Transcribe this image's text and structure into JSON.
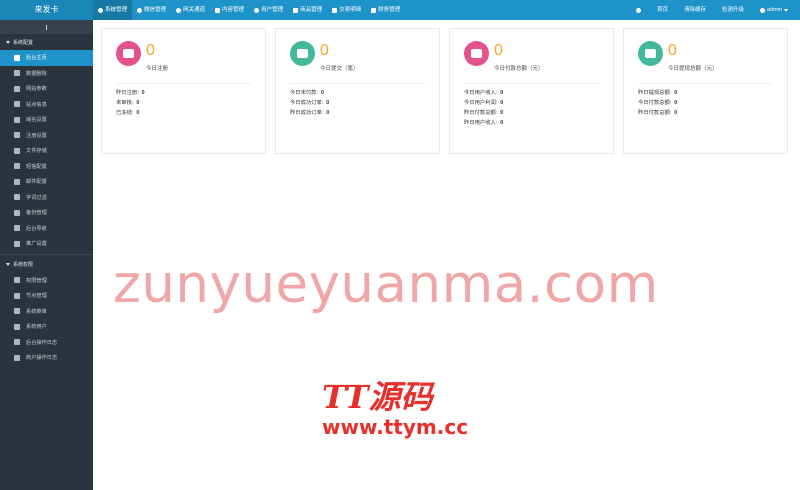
{
  "brand": "来发卡",
  "topnav": {
    "left": [
      {
        "label": "系统管理",
        "active": true,
        "icon": "gear-icon"
      },
      {
        "label": "微信管理",
        "active": false,
        "icon": "wechat-icon"
      },
      {
        "label": "网关通道",
        "active": false,
        "icon": "globe-icon"
      },
      {
        "label": "内容管理",
        "active": false,
        "icon": "document-icon"
      },
      {
        "label": "用户管理",
        "active": false,
        "icon": "users-icon"
      },
      {
        "label": "商品管理",
        "active": false,
        "icon": "bank-icon"
      },
      {
        "label": "交易明细",
        "active": false,
        "icon": "bar-chart-icon"
      },
      {
        "label": "财务管理",
        "active": false,
        "icon": "money-icon"
      }
    ],
    "right": {
      "refresh_icon": "refresh-icon",
      "home": "首页",
      "clear_cache": "清除缓存",
      "check_update": "检测升级",
      "user": "admin"
    }
  },
  "sidebar": {
    "group1": {
      "title": "系统配置",
      "items": [
        {
          "label": "后台主页",
          "active": true,
          "icon": "area-chart-icon"
        },
        {
          "label": "数据删除",
          "active": false,
          "icon": "link-icon"
        },
        {
          "label": "网站参数",
          "active": false,
          "icon": "apple-icon"
        },
        {
          "label": "站点信息",
          "active": false,
          "icon": "info-icon"
        },
        {
          "label": "域名设置",
          "active": false,
          "icon": "globe-icon"
        },
        {
          "label": "注册设置",
          "active": false,
          "icon": "gear-icon"
        },
        {
          "label": "文件存储",
          "active": false,
          "icon": "save-icon"
        },
        {
          "label": "短信配置",
          "active": false,
          "icon": "envelope-icon"
        },
        {
          "label": "邮件配置",
          "active": false,
          "icon": "mail-icon"
        },
        {
          "label": "字词过滤",
          "active": false,
          "icon": "filter-icon"
        },
        {
          "label": "备份管理",
          "active": false,
          "icon": "database-icon"
        },
        {
          "label": "后台导航",
          "active": false,
          "icon": "list-icon"
        },
        {
          "label": "推广设置",
          "active": false,
          "icon": "megaphone-icon"
        }
      ]
    },
    "group2": {
      "title": "系统权限",
      "items": [
        {
          "label": "权限管理",
          "active": false,
          "icon": "bank-icon"
        },
        {
          "label": "节点管理",
          "active": false,
          "icon": "info-icon"
        },
        {
          "label": "系统菜单",
          "active": false,
          "icon": "menu-icon"
        },
        {
          "label": "系统用户",
          "active": false,
          "icon": "users-icon"
        },
        {
          "label": "后台操作日志",
          "active": false,
          "icon": "terminal-icon"
        },
        {
          "label": "商户操作日志",
          "active": false,
          "icon": "pin-icon"
        }
      ]
    }
  },
  "cards": [
    {
      "value": "0",
      "title": "今日注册",
      "color": "#e4528b",
      "icon": "users-icon",
      "stats": [
        {
          "label": "昨日注册:",
          "value": "0"
        },
        {
          "label": "未审核:",
          "value": "0"
        },
        {
          "label": "已冻结:",
          "value": "0"
        }
      ]
    },
    {
      "value": "0",
      "title": "今日提交（笔）",
      "color": "#44b89a",
      "icon": "calendar-icon",
      "stats": [
        {
          "label": "今日未付款:",
          "value": "0"
        },
        {
          "label": "今日成功订单:",
          "value": "0"
        },
        {
          "label": "昨日成功订单:",
          "value": "0"
        }
      ]
    },
    {
      "value": "0",
      "title": "今日付款总额（元）",
      "color": "#e4528b",
      "icon": "credit-card-icon",
      "stats": [
        {
          "label": "今日用户收入:",
          "value": "0"
        },
        {
          "label": "今日用户利润:",
          "value": "0"
        },
        {
          "label": "昨日付款总额:",
          "value": "0"
        },
        {
          "label": "昨日用户收入:",
          "value": "0"
        }
      ]
    },
    {
      "value": "0",
      "title": "今日提现总额（元）",
      "color": "#44b89a",
      "icon": "database-icon",
      "stats": [
        {
          "label": "昨日提现总额:",
          "value": "0"
        },
        {
          "label": "今日付款总额:",
          "value": "0"
        },
        {
          "label": "昨日付款总额:",
          "value": "0"
        }
      ]
    }
  ],
  "watermark": {
    "text": "zunyueyuanma.com",
    "logo_cn": "TT源码",
    "logo_url": "www.ttym.cc"
  }
}
